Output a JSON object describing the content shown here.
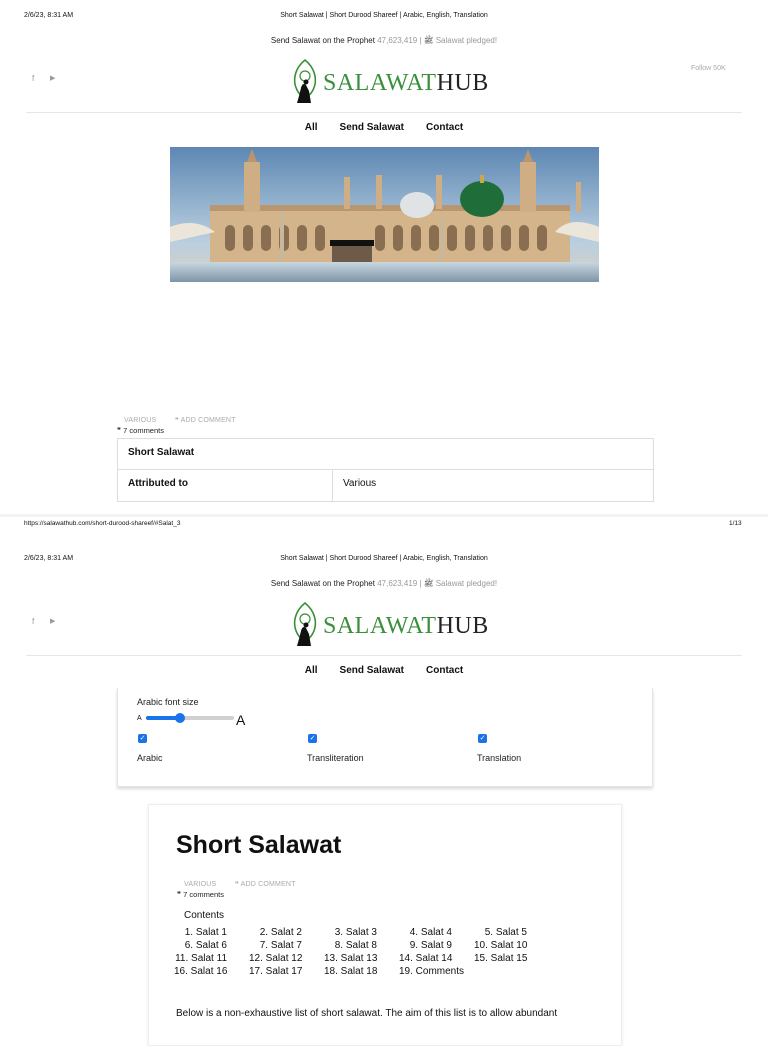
{
  "page1": {
    "datetime": "2/6/23, 8:31 AM",
    "tab_title": "Short Salawat | Short Durood Shareef | Arabic, English, Translation",
    "announcement": {
      "text": "Send Salawat on the Prophet ﷺ",
      "count_text": "| 47,623,419 Salawat pledged!"
    },
    "social": {
      "facebook": "f",
      "youtube": "▶"
    },
    "follow_text": "Follow 50K",
    "logo": {
      "part1": "SALAWAT",
      "part2": "HUB"
    },
    "nav": [
      "All",
      "Send Salawat",
      "Contact"
    ],
    "meta": {
      "category": "VARIOUS",
      "add_comment": "ADD COMMENT",
      "comments": "7 comments"
    },
    "info_table": {
      "title": "Short Salawat",
      "row_label": "Attributed to",
      "row_value": "Various"
    },
    "footer_url": "https://salawathub.com/short-durood-shareef/#Salat_3",
    "page_num": "1/13"
  },
  "page2": {
    "datetime": "2/6/23, 8:31 AM",
    "tab_title": "Short Salawat | Short Durood Shareef | Arabic, English, Translation",
    "announcement": {
      "text": "Send Salawat on the Prophet ﷺ",
      "count_text": "| 47,623,419 Salawat pledged!"
    },
    "logo": {
      "part1": "SALAWAT",
      "part2": "HUB"
    },
    "nav": [
      "All",
      "Send Salawat",
      "Contact"
    ],
    "settings": {
      "font_size_label": "Arabic font size",
      "small_a": "A",
      "large_a": "A",
      "slider_value": 0.4,
      "checkboxes": [
        {
          "label": "Arabic",
          "checked": true
        },
        {
          "label": "Transliteration",
          "checked": true
        },
        {
          "label": "Translation",
          "checked": true
        }
      ]
    },
    "article": {
      "title": "Short Salawat",
      "category": "VARIOUS",
      "add_comment": "ADD COMMENT",
      "comments": "7 comments",
      "contents_label": "Contents",
      "toc": [
        "1. Salat 1",
        "2. Salat 2",
        "3. Salat 3",
        "4. Salat 4",
        "5. Salat 5",
        "6. Salat 6",
        "7. Salat 7",
        "8. Salat 8",
        "9. Salat 9",
        "10. Salat 10",
        "11. Salat 11",
        "12. Salat 12",
        "13. Salat 13",
        "14. Salat 14",
        "15. Salat 15",
        "16. Salat 16",
        "17. Salat 17",
        "18. Salat 18",
        "19. Comments"
      ],
      "intro": "Below is a non-exhaustive list of short salawat. The aim of this list is to allow abundant"
    }
  },
  "colors": {
    "accent": "#3a8f3a",
    "link_blue": "#1a73e8",
    "muted": "#999999"
  }
}
